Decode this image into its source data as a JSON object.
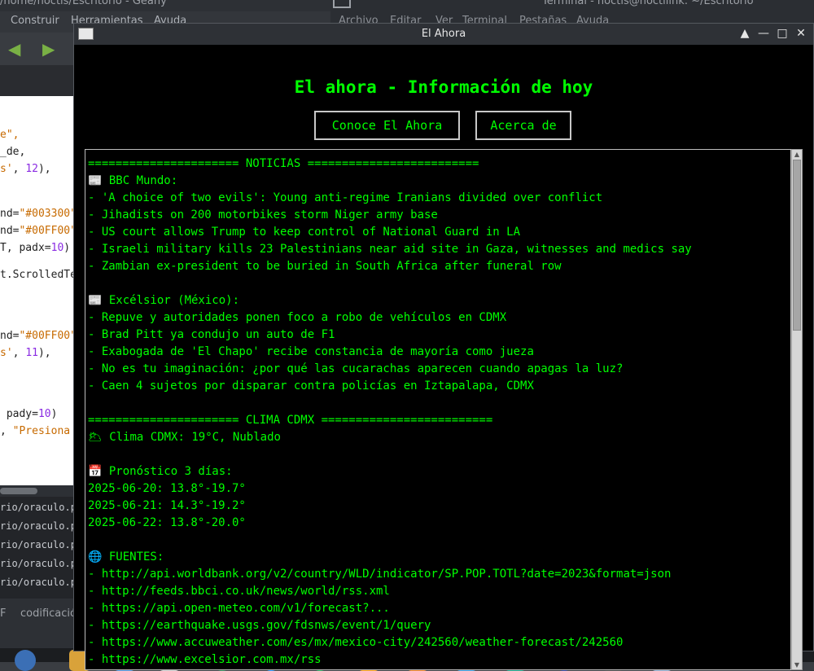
{
  "background_geany": {
    "title_fragment": "/home/noctis/Escritorio - Geany",
    "menu": [
      "Construir",
      "Herramientas",
      "Ayuda"
    ],
    "code_lines": [
      {
        "segments": [
          {
            "t": "e\",",
            "c": "str"
          }
        ]
      },
      {
        "segments": [
          {
            "t": "_de,",
            "c": ""
          }
        ]
      },
      {
        "segments": [
          {
            "t": "s'",
            "c": "str"
          },
          {
            "t": ", ",
            "c": ""
          },
          {
            "t": "12",
            "c": "num"
          },
          {
            "t": "),",
            "c": ""
          }
        ]
      },
      {
        "segments": [
          {
            "t": "nd=",
            "c": ""
          },
          {
            "t": "\"#003300\"",
            "c": "str"
          }
        ]
      },
      {
        "segments": [
          {
            "t": "nd=",
            "c": ""
          },
          {
            "t": "\"#00FF00\"",
            "c": "str"
          }
        ]
      },
      {
        "segments": [
          {
            "t": "T, padx=",
            "c": ""
          },
          {
            "t": "10",
            "c": "num"
          },
          {
            "t": ")",
            "c": ""
          }
        ]
      },
      {
        "segments": [
          {
            "t": "t.ScrolledTe",
            "c": ""
          }
        ]
      },
      {
        "segments": [
          {
            "t": "nd=",
            "c": ""
          },
          {
            "t": "\"#00FF00\"",
            "c": "str"
          }
        ]
      },
      {
        "segments": [
          {
            "t": "s'",
            "c": "str"
          },
          {
            "t": ", ",
            "c": ""
          },
          {
            "t": "11",
            "c": "num"
          },
          {
            "t": "),",
            "c": ""
          }
        ]
      },
      {
        "segments": [
          {
            "t": " pady=",
            "c": ""
          },
          {
            "t": "10",
            "c": "num"
          },
          {
            "t": ")",
            "c": ""
          }
        ]
      },
      {
        "segments": [
          {
            "t": ", ",
            "c": ""
          },
          {
            "t": "\"Presiona",
            "c": "str"
          }
        ]
      }
    ],
    "messages": [
      "rio/oraculo.p",
      "rio/oraculo.p",
      "rio/oraculo.p",
      "rio/oraculo.p",
      "rio/oraculo.p"
    ],
    "status": [
      "F",
      "codificació"
    ]
  },
  "background_terminal": {
    "title_fragment": "Terminal - noctis@noctilink: ~/Escritorio",
    "menu": [
      "Archivo",
      "Editar",
      "Ver",
      "Terminal",
      "Pestañas",
      "Ayuda"
    ]
  },
  "window": {
    "title": "El Ahora",
    "controls": [
      "▲",
      "—",
      "□",
      "✕"
    ]
  },
  "app": {
    "heading": "El ahora - Información de hoy",
    "buttons": {
      "conoce": "Conoce El Ahora",
      "acerca": "Acerca de"
    },
    "lines": [
      "====================== NOTICIAS =========================",
      "📰 BBC Mundo:",
      "- 'A choice of two evils': Young anti-regime Iranians divided over conflict",
      "- Jihadists on 200 motorbikes storm Niger army base",
      "- US court allows Trump to keep control of National Guard in LA",
      "- Israeli military kills 23 Palestinians near aid site in Gaza, witnesses and medics say",
      "- Zambian ex-president to be buried in South Africa after funeral row",
      "",
      "📰 Excélsior (México):",
      "- Repuve y autoridades ponen foco a robo de vehículos en CDMX",
      "- Brad Pitt ya condujo un auto de F1",
      "- Exabogada de 'El Chapo' recibe constancia de mayoría como jueza",
      "- No es tu imaginación: ¿por qué las cucarachas aparecen cuando apagas la luz?",
      "- Caen 4 sujetos por disparar contra policías en Iztapalapa, CDMX",
      "",
      "====================== CLIMA CDMX =========================",
      "🌥 Clima CDMX: 19°C, Nublado",
      "",
      "📅 Pronóstico 3 días:",
      "2025-06-20: 13.8°-19.7°",
      "2025-06-21: 14.3°-19.2°",
      "2025-06-22: 13.8°-20.0°",
      "",
      "🌐 FUENTES:",
      "- http://api.worldbank.org/v2/country/WLD/indicator/SP.POP.TOTL?date=2023&format=json",
      "- http://feeds.bbci.co.uk/news/world/rss.xml",
      "- https://api.open-meteo.com/v1/forecast?...",
      "- https://earthquake.usgs.gov/fdsnws/event/1/query",
      "- https://www.accuweather.com/es/mx/mexico-city/242560/weather-forecast/242560",
      "- https://www.excelsior.com.mx/rss"
    ]
  },
  "colors": {
    "text": "#00ff00",
    "background": "#000000",
    "button_border": "#c8c8c8"
  }
}
